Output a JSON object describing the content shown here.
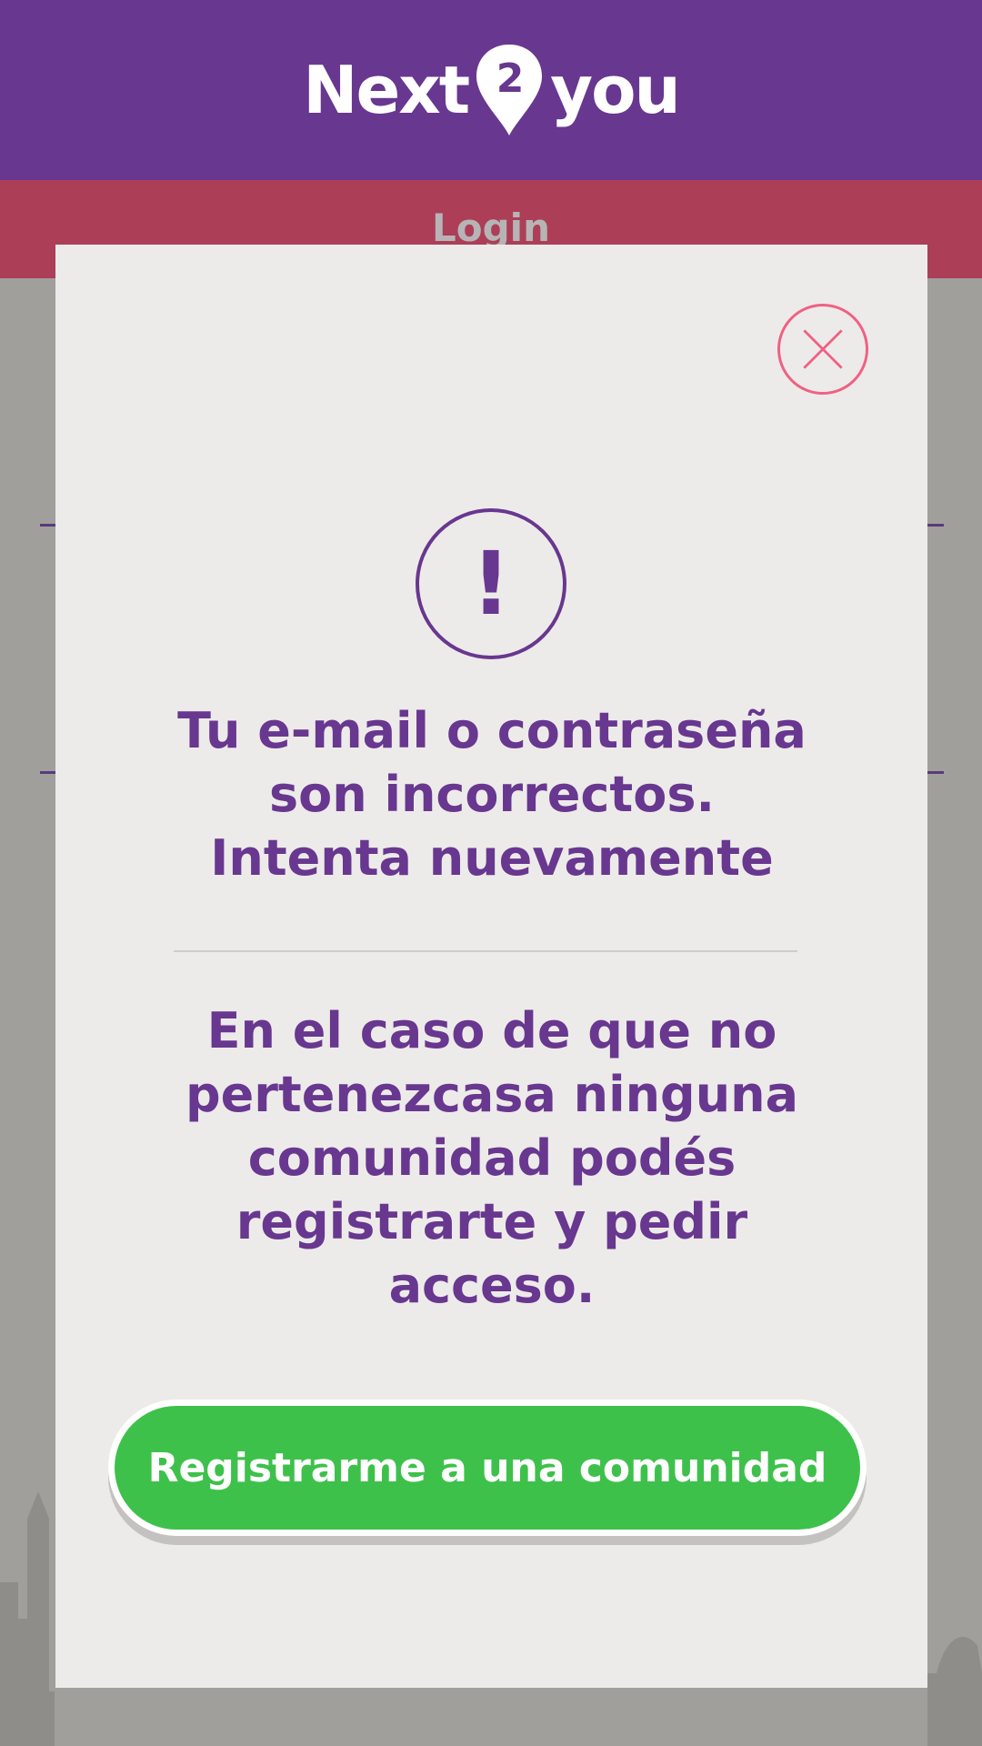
{
  "header": {
    "logo_text_left": "Next",
    "logo_pin_number": "2",
    "logo_text_right": "you",
    "bg_color": "#68378f"
  },
  "subheader": {
    "title": "Login",
    "bg_color": "#ad3e58"
  },
  "modal": {
    "close_icon": "close-icon",
    "alert_icon": "exclamation-icon",
    "alert_symbol": "!",
    "error_lines": [
      "Tu e-mail o contraseña",
      "son incorrectos.",
      "Intenta nuevamente"
    ],
    "info_lines": [
      "En el caso de que no",
      "pertenezcasa ninguna",
      "comunidad podés",
      "registrarte y pedir",
      "acceso."
    ],
    "register_button_label": "Registrarme a una comunidad",
    "accent_color": "#68378f",
    "close_color": "#f06183",
    "button_color": "#3ec14b"
  }
}
